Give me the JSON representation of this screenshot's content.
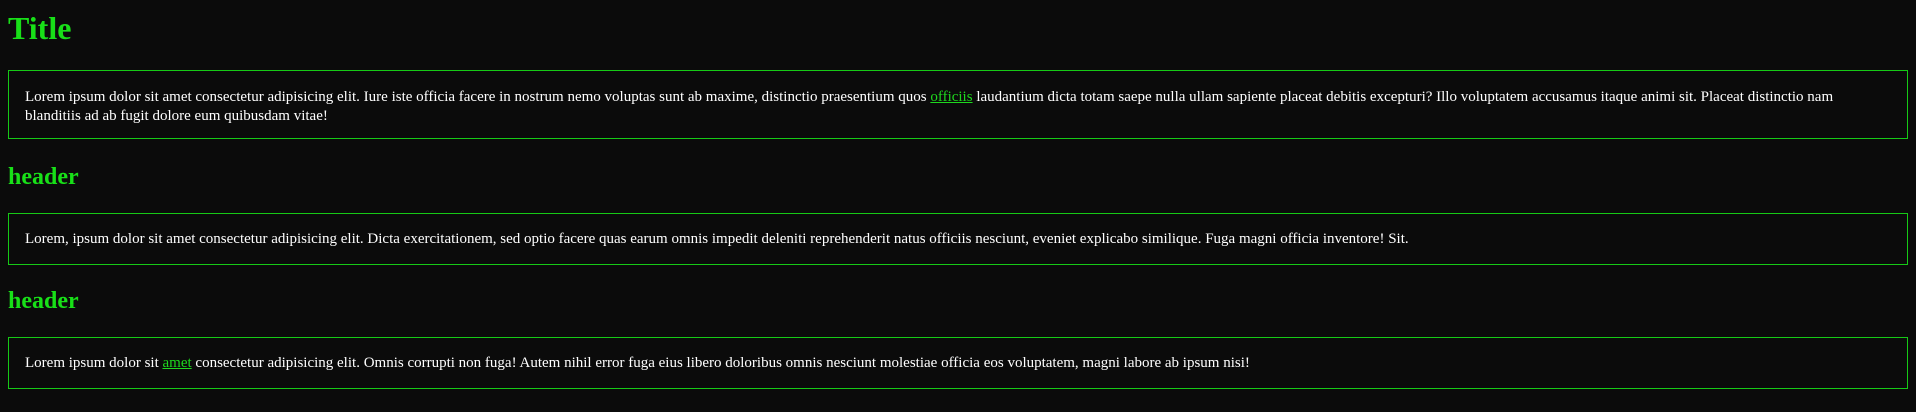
{
  "title": "Title",
  "sections": [
    {
      "header": "",
      "text_before_link": "Lorem ipsum dolor sit amet consectetur adipisicing elit. Iure iste officia facere in nostrum nemo voluptas sunt ab maxime, distinctio praesentium quos ",
      "link": "officiis",
      "text_after_link": " laudantium dicta totam saepe nulla ullam sapiente placeat debitis excepturi? Illo voluptatem accusamus itaque animi sit. Placeat distinctio nam blanditiis ad ab fugit dolore eum quibusdam vitae!"
    },
    {
      "header": "header",
      "text": "Lorem, ipsum dolor sit amet consectetur adipisicing elit. Dicta exercitationem, sed optio facere quas earum omnis impedit deleniti reprehenderit natus officiis nesciunt, eveniet explicabo similique. Fuga magni officia inventore! Sit."
    },
    {
      "header": "header",
      "text_before_link": "Lorem ipsum dolor sit ",
      "link": "amet",
      "text_after_link": " consectetur adipisicing elit. Omnis corrupti non fuga! Autem nihil error fuga eius libero doloribus omnis nesciunt molestiae officia eos voluptatem, magni labore ab ipsum nisi!"
    }
  ],
  "colors": {
    "background": "#0b0b0b",
    "accent": "#18e018",
    "text": "#ffffff"
  }
}
